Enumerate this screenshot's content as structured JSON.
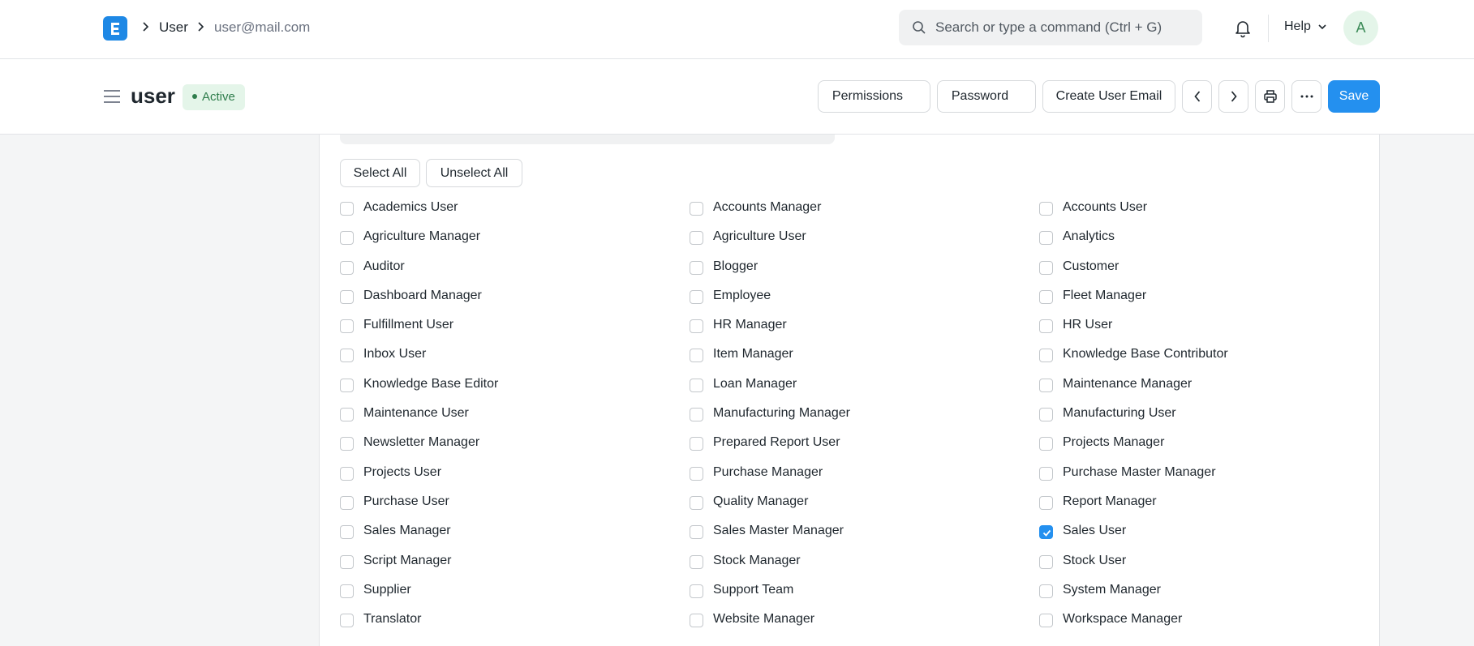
{
  "navbar": {
    "breadcrumbs": [
      "User",
      "user@mail.com"
    ],
    "search_placeholder": "Search or type a command (Ctrl + G)",
    "help_label": "Help",
    "avatar_initial": "A"
  },
  "page": {
    "title": "user",
    "status": "Active"
  },
  "toolbar": {
    "permissions_label": "Permissions",
    "password_label": "Password",
    "create_email_label": "Create User Email",
    "save_label": "Save"
  },
  "roles_section": {
    "select_all_label": "Select All",
    "unselect_all_label": "Unselect All",
    "roles": [
      {
        "label": "Academics User",
        "checked": false
      },
      {
        "label": "Accounts Manager",
        "checked": false
      },
      {
        "label": "Accounts User",
        "checked": false
      },
      {
        "label": "Agriculture Manager",
        "checked": false
      },
      {
        "label": "Agriculture User",
        "checked": false
      },
      {
        "label": "Analytics",
        "checked": false
      },
      {
        "label": "Auditor",
        "checked": false
      },
      {
        "label": "Blogger",
        "checked": false
      },
      {
        "label": "Customer",
        "checked": false
      },
      {
        "label": "Dashboard Manager",
        "checked": false
      },
      {
        "label": "Employee",
        "checked": false
      },
      {
        "label": "Fleet Manager",
        "checked": false
      },
      {
        "label": "Fulfillment User",
        "checked": false
      },
      {
        "label": "HR Manager",
        "checked": false
      },
      {
        "label": "HR User",
        "checked": false
      },
      {
        "label": "Inbox User",
        "checked": false
      },
      {
        "label": "Item Manager",
        "checked": false
      },
      {
        "label": "Knowledge Base Contributor",
        "checked": false
      },
      {
        "label": "Knowledge Base Editor",
        "checked": false
      },
      {
        "label": "Loan Manager",
        "checked": false
      },
      {
        "label": "Maintenance Manager",
        "checked": false
      },
      {
        "label": "Maintenance User",
        "checked": false
      },
      {
        "label": "Manufacturing Manager",
        "checked": false
      },
      {
        "label": "Manufacturing User",
        "checked": false
      },
      {
        "label": "Newsletter Manager",
        "checked": false
      },
      {
        "label": "Prepared Report User",
        "checked": false
      },
      {
        "label": "Projects Manager",
        "checked": false
      },
      {
        "label": "Projects User",
        "checked": false
      },
      {
        "label": "Purchase Manager",
        "checked": false
      },
      {
        "label": "Purchase Master Manager",
        "checked": false
      },
      {
        "label": "Purchase User",
        "checked": false
      },
      {
        "label": "Quality Manager",
        "checked": false
      },
      {
        "label": "Report Manager",
        "checked": false
      },
      {
        "label": "Sales Manager",
        "checked": false
      },
      {
        "label": "Sales Master Manager",
        "checked": false
      },
      {
        "label": "Sales User",
        "checked": true
      },
      {
        "label": "Script Manager",
        "checked": false
      },
      {
        "label": "Stock Manager",
        "checked": false
      },
      {
        "label": "Stock User",
        "checked": false
      },
      {
        "label": "Supplier",
        "checked": false
      },
      {
        "label": "Support Team",
        "checked": false
      },
      {
        "label": "System Manager",
        "checked": false
      },
      {
        "label": "Translator",
        "checked": false
      },
      {
        "label": "Website Manager",
        "checked": false
      },
      {
        "label": "Workspace Manager",
        "checked": false
      }
    ]
  },
  "colors": {
    "accent": "#2490ef",
    "logo": "#1e88e5",
    "active_badge_bg": "#e4f5e9",
    "active_badge_text": "#2f7d4c"
  }
}
